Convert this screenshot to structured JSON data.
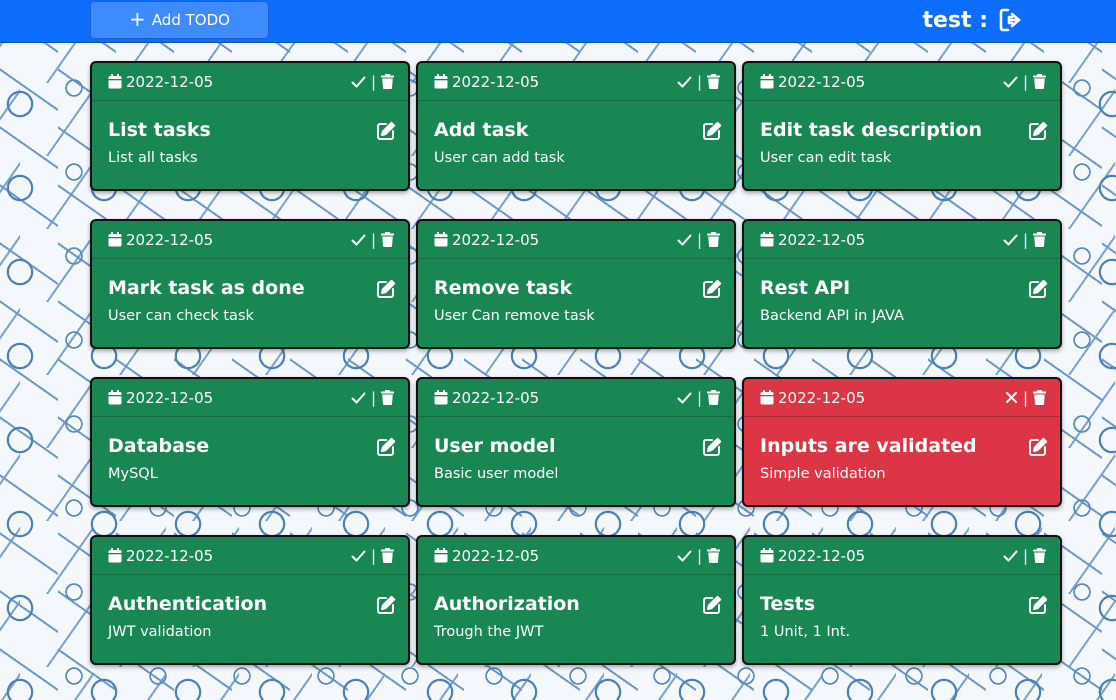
{
  "header": {
    "add_label": "Add TODO",
    "username": "test :"
  },
  "todos": [
    {
      "date": "2022-12-05",
      "title": "List tasks",
      "description": "List all tasks",
      "status": "done"
    },
    {
      "date": "2022-12-05",
      "title": "Add task",
      "description": "User can add task",
      "status": "done"
    },
    {
      "date": "2022-12-05",
      "title": "Edit task description",
      "description": "User can edit task",
      "status": "done"
    },
    {
      "date": "2022-12-05",
      "title": "Mark task as done",
      "description": "User can check task",
      "status": "done"
    },
    {
      "date": "2022-12-05",
      "title": "Remove task",
      "description": "User Can remove task",
      "status": "done"
    },
    {
      "date": "2022-12-05",
      "title": "Rest API",
      "description": "Backend API in JAVA",
      "status": "done"
    },
    {
      "date": "2022-12-05",
      "title": "Database",
      "description": "MySQL",
      "status": "done"
    },
    {
      "date": "2022-12-05",
      "title": "User model",
      "description": "Basic user model",
      "status": "done"
    },
    {
      "date": "2022-12-05",
      "title": "Inputs are validated",
      "description": "Simple validation",
      "status": "failed"
    },
    {
      "date": "2022-12-05",
      "title": "Authentication",
      "description": "JWT validation",
      "status": "done"
    },
    {
      "date": "2022-12-05",
      "title": "Authorization",
      "description": "Trough the JWT",
      "status": "done"
    },
    {
      "date": "2022-12-05",
      "title": "Tests",
      "description": "1 Unit, 1 Int.",
      "status": "done"
    }
  ],
  "icons": {
    "date": "calendar-icon",
    "done_toggle": "check-icon",
    "failed_toggle": "x-icon",
    "delete": "trash-icon",
    "edit": "edit-icon",
    "logout": "logout-icon",
    "add": "plus-icon"
  },
  "colors": {
    "topbar": "#0d6efd",
    "add_button": "#3d8bfd",
    "card_done": "#198754",
    "card_failed": "#dc3545"
  }
}
